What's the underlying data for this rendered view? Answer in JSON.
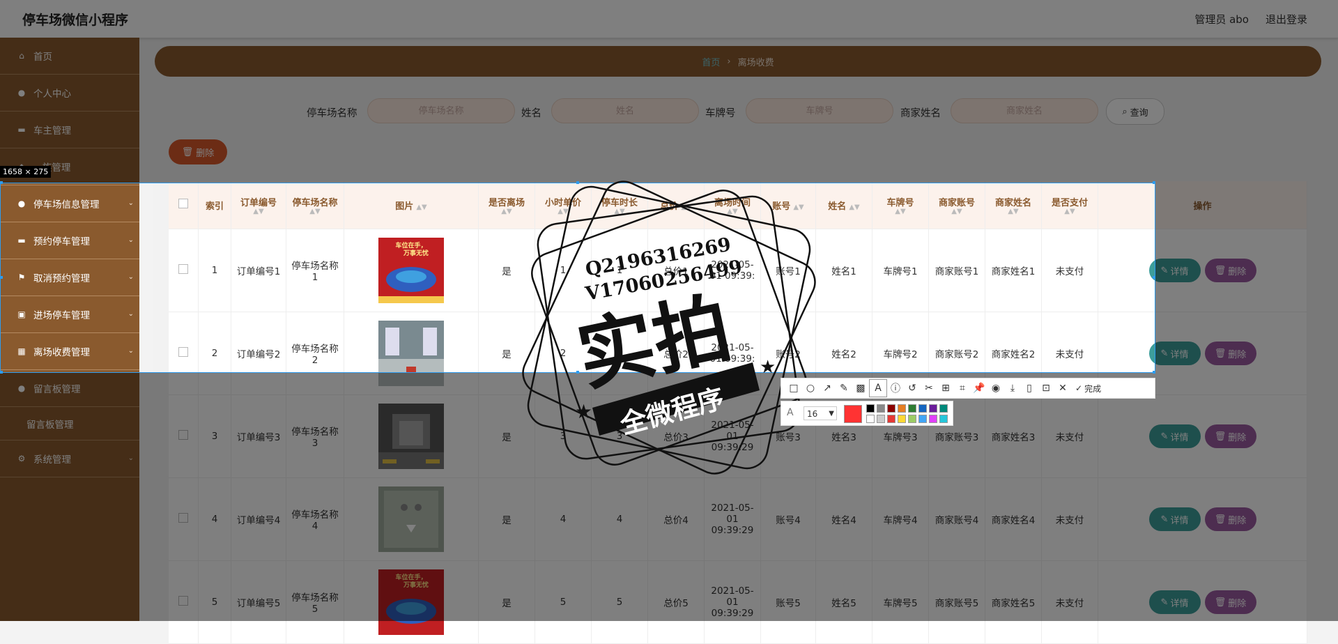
{
  "header": {
    "title": "停车场微信小程序",
    "admin": "管理员 abo",
    "logout": "退出登录"
  },
  "sidebar": {
    "items": [
      {
        "label": "首页"
      },
      {
        "label": "个人中心"
      },
      {
        "label": "车主管理"
      },
      {
        "label": "...族管理"
      },
      {
        "label": "停车场信息管理"
      },
      {
        "label": "预约停车管理"
      },
      {
        "label": "取消预约管理"
      },
      {
        "label": "进场停车管理"
      },
      {
        "label": "离场收费管理"
      },
      {
        "label": "留言板管理"
      },
      {
        "label": "留言板管理"
      },
      {
        "label": "系统管理"
      }
    ]
  },
  "breadcrumb": {
    "home": "首页",
    "current": "离场收费"
  },
  "search": {
    "lot_label": "停车场名称",
    "lot_placeholder": "停车场名称",
    "name_label": "姓名",
    "name_placeholder": "姓名",
    "plate_label": "车牌号",
    "plate_placeholder": "车牌号",
    "merchant_label": "商家姓名",
    "merchant_placeholder": "商家姓名",
    "button": "查询"
  },
  "actions": {
    "delete": "删除",
    "detail": "详情",
    "row_delete": "删除"
  },
  "table": {
    "headers": [
      "索引",
      "订单编号",
      "停车场名称",
      "图片",
      "是否离场",
      "小时单价",
      "停车时长",
      "总价",
      "离场时间",
      "账号",
      "姓名",
      "车牌号",
      "商家账号",
      "商家姓名",
      "是否支付",
      "操作"
    ],
    "rows": [
      {
        "idx": "1",
        "order": "订单编号1",
        "lot": "停车场名称1",
        "leave": "是",
        "price": "1",
        "dur": "1",
        "total": "总价1",
        "time": "2021-05-01 09:39:",
        "acct": "账号1",
        "name": "姓名1",
        "plate": "车牌号1",
        "macct": "商家账号1",
        "mname": "商家姓名1",
        "paid": "未支付"
      },
      {
        "idx": "2",
        "order": "订单编号2",
        "lot": "停车场名称2",
        "leave": "是",
        "price": "2",
        "dur": "2",
        "total": "总价2",
        "time": "2021-05-01 09:39:",
        "acct": "账号2",
        "name": "姓名2",
        "plate": "车牌号2",
        "macct": "商家账号2",
        "mname": "商家姓名2",
        "paid": "未支付"
      },
      {
        "idx": "3",
        "order": "订单编号3",
        "lot": "停车场名称3",
        "leave": "是",
        "price": "3",
        "dur": "3",
        "total": "总价3",
        "time": "2021-05-01 09:39:29",
        "acct": "账号3",
        "name": "姓名3",
        "plate": "车牌号3",
        "macct": "商家账号3",
        "mname": "商家姓名3",
        "paid": "未支付"
      },
      {
        "idx": "4",
        "order": "订单编号4",
        "lot": "停车场名称4",
        "leave": "是",
        "price": "4",
        "dur": "4",
        "total": "总价4",
        "time": "2021-05-01 09:39:29",
        "acct": "账号4",
        "name": "姓名4",
        "plate": "车牌号4",
        "macct": "商家账号4",
        "mname": "商家姓名4",
        "paid": "未支付"
      },
      {
        "idx": "5",
        "order": "订单编号5",
        "lot": "停车场名称5",
        "leave": "是",
        "price": "5",
        "dur": "5",
        "total": "总价5",
        "time": "2021-05-01 09:39:29",
        "acct": "账号5",
        "name": "姓名5",
        "plate": "车牌号5",
        "macct": "商家账号5",
        "mname": "商家姓名5",
        "paid": "未支付"
      }
    ]
  },
  "thumb_texts": [
    "车位在手，万事无忧"
  ],
  "capture": {
    "size": "1658 × 275",
    "done": "完成",
    "font_size": "16"
  },
  "watermark": {
    "line1": "Q2196316269",
    "line2": "V17060256499",
    "big": "实拍",
    "banner": "全微程序"
  },
  "colors": {
    "brown": "#8a5a2e",
    "teal": "#3d9e9b",
    "purple": "#9a5aa0",
    "orange": "#d9582b"
  }
}
